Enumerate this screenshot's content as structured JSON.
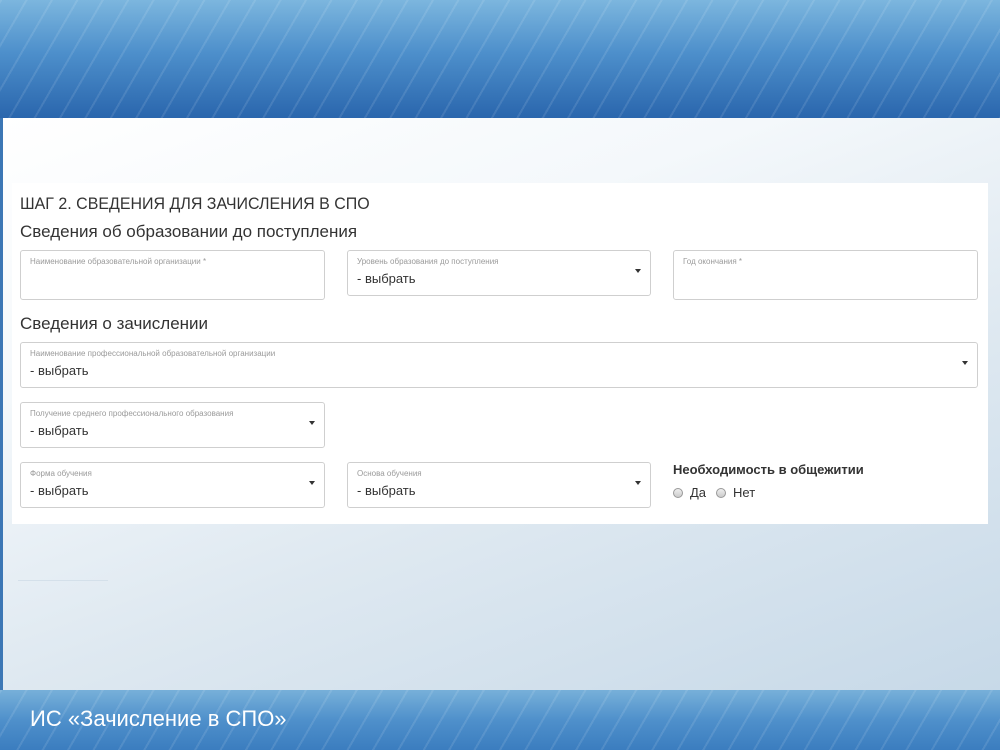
{
  "header": {
    "step_title": "ШАГ 2. СВЕДЕНИЯ ДЛЯ ЗАЧИСЛЕНИЯ В СПО"
  },
  "education_section": {
    "title": "Сведения об образовании до поступления",
    "org_name": {
      "label": "Наименование образовательной организации *",
      "value": ""
    },
    "level": {
      "label": "Уровень образования до поступления",
      "value": "- выбрать"
    },
    "grad_year": {
      "label": "Год окончания *",
      "value": ""
    }
  },
  "enrollment_section": {
    "title": "Сведения о зачислении",
    "prof_org": {
      "label": "Наименование профессиональной образовательной организации",
      "value": "- выбрать"
    },
    "spo_mode": {
      "label": "Получение среднего профессионального образования",
      "value": "- выбрать"
    },
    "study_form": {
      "label": "Форма обучения",
      "value": "- выбрать"
    },
    "study_basis": {
      "label": "Основа обучения",
      "value": "- выбрать"
    },
    "dormitory": {
      "title": "Необходимость в общежитии",
      "options": [
        "Да",
        "Нет"
      ]
    }
  },
  "footer": {
    "text": "ИС «Зачисление в СПО»"
  },
  "colors": {
    "banner_top": "#7cb6de",
    "banner_bottom": "#2a66ad",
    "text": "#333333",
    "label": "#9a9a9a",
    "border": "#cfcfcf"
  }
}
